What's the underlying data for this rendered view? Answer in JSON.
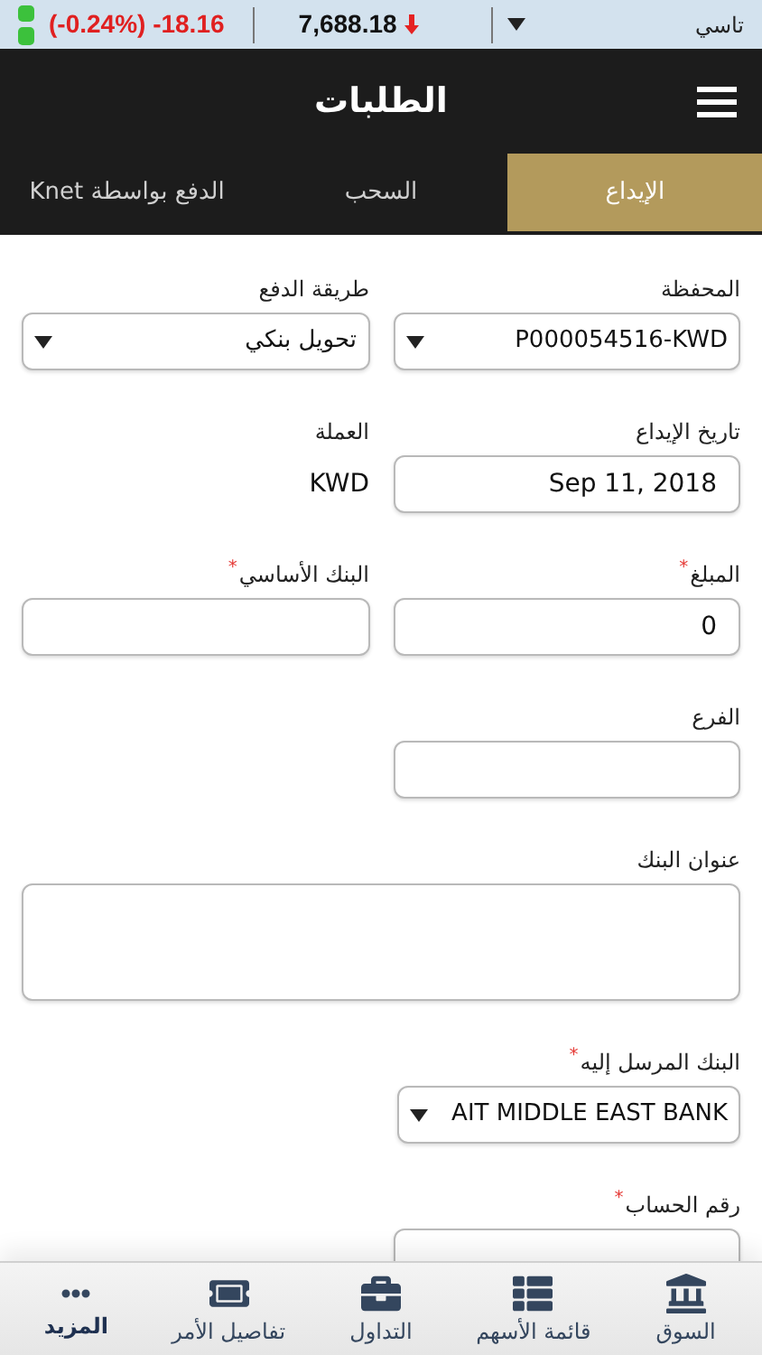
{
  "ticker": {
    "change": "(-0.24%) -18.16",
    "index_value": "7,688.18",
    "market": "تاسي"
  },
  "header": {
    "title": "الطلبات"
  },
  "tabs": [
    {
      "label": "الإيداع",
      "selected": true
    },
    {
      "label": "السحب",
      "selected": false
    },
    {
      "label": "الدفع بواسطة Knet",
      "selected": false
    }
  ],
  "form_rows": [
    [
      {
        "kind": "select",
        "label": "المحفظة",
        "value": "P000054516-KWD"
      },
      {
        "kind": "select",
        "label": "طريقة الدفع",
        "value": "تحويل بنكي"
      }
    ],
    [
      {
        "kind": "input",
        "label": "تاريخ الإيداع",
        "value": "Sep 11, 2018"
      },
      {
        "kind": "text",
        "label": "العملة",
        "value": "KWD"
      }
    ],
    [
      {
        "kind": "input",
        "label": "المبلغ",
        "required_mark": "*",
        "value": "0"
      },
      {
        "kind": "input",
        "label": "البنك الأساسي",
        "required_mark": "*"
      }
    ],
    [
      {
        "kind": "input",
        "label": "الفرع"
      }
    ],
    [
      {
        "kind": "textarea",
        "label": "عنوان البنك"
      }
    ],
    [
      {
        "kind": "select",
        "label": "البنك المرسل إليه",
        "required_mark": "*",
        "value": "AIT MIDDLE EAST BANK"
      }
    ],
    [
      {
        "kind": "input",
        "label": "رقم الحساب",
        "required_mark": "*"
      }
    ]
  ],
  "bottom_nav": [
    {
      "label": "السوق",
      "selected": false
    },
    {
      "label": "قائمة الأسهم",
      "selected": false
    },
    {
      "label": "التداول",
      "selected": false
    },
    {
      "label": "تفاصيل الأمر",
      "selected": false
    },
    {
      "label": "المزيد",
      "selected": true
    }
  ]
}
